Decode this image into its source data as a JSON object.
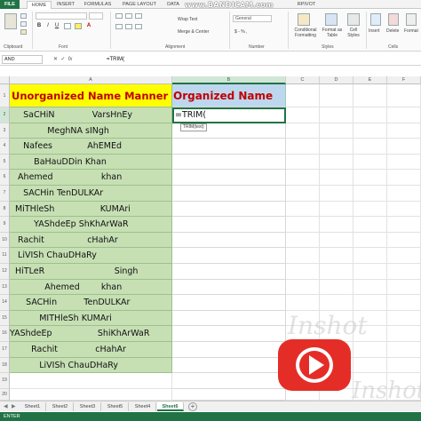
{
  "ribbon_tabs": [
    "FILE",
    "HOME",
    "INSERT",
    "FORMULAS",
    "PAGE LAYOUT",
    "DATA",
    "RPIVOT"
  ],
  "recorder_overlay": "www.BANDICAM.com",
  "ribbon": {
    "groups": [
      "Clipboard",
      "Font",
      "Alignment",
      "Number",
      "Styles",
      "Cells"
    ],
    "wrap_text": "Wrap Text",
    "merge_center": "Merge & Center",
    "number_format": "General",
    "conditional_formatting": "Conditional Formatting",
    "format_as_table": "Format as Table",
    "cell_styles": "Cell Styles",
    "insert": "Insert",
    "delete": "Delete",
    "format": "Format",
    "currency": "$ - % ,"
  },
  "formula_bar": {
    "name_box": "AND",
    "formula": "=TRIM("
  },
  "columns": [
    "A",
    "B",
    "C",
    "D",
    "E",
    "F"
  ],
  "rows": [
    "1",
    "2",
    "3",
    "4",
    "5",
    "6",
    "7",
    "8",
    "9",
    "10",
    "11",
    "12",
    "13",
    "14",
    "15",
    "16",
    "17",
    "18",
    "19",
    "20",
    "21"
  ],
  "colA_header": "Unorganized Name Manner",
  "colB_header": "Organized Name",
  "editing_cell": "=TRIM(",
  "tooltip": "TRIM(text)",
  "names": [
    "     SaCHiN              VarsHnEy",
    "              MeghNA sINgh",
    "     Nafees             AhEMEd",
    "         BaHauDDin Khan",
    "   Ahemed                  khan",
    "     SACHin TenDULKAr",
    "  MiTHleSh                 KUMAri",
    "         YAShdeEp ShKhArWaR",
    "   Rachit                cHahAr",
    "   LiVISh ChauDHaRy",
    "  HiTLeR                          Singh",
    "             Ahemed        khan",
    "      SACHin          TenDULKAr",
    "           MITHleSh KUMAri",
    "YAShdeEp                 ShiKhArWaR",
    "        Rachit              cHahAr",
    "           LiVISh ChauDHaRy"
  ],
  "sheets": [
    "Sheet1",
    "Sheet2",
    "Sheet3",
    "Sheet5",
    "Sheet4",
    "Sheet6"
  ],
  "active_sheet": "Sheet6",
  "status": "ENTER",
  "watermark": "Inshot",
  "colors": {
    "excel_green": "#217346",
    "name_fill": "#c6e0b4",
    "header_a_fill": "#ffff00",
    "header_b_fill": "#bdd7ee",
    "header_text": "#c00000",
    "youtube_red": "#e52d27"
  }
}
